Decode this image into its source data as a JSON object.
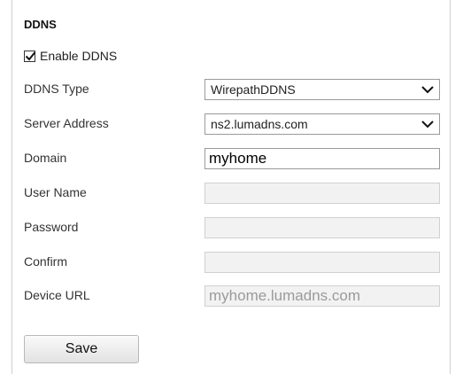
{
  "section_title": "DDNS",
  "enable": {
    "label": "Enable DDNS",
    "checked": true
  },
  "fields": {
    "ddns_type": {
      "label": "DDNS Type",
      "value": "WirepathDDNS"
    },
    "server_address": {
      "label": "Server Address",
      "value": "ns2.lumadns.com"
    },
    "domain": {
      "label": "Domain",
      "value": "myhome"
    },
    "user_name": {
      "label": "User Name",
      "value": ""
    },
    "password": {
      "label": "Password",
      "value": ""
    },
    "confirm": {
      "label": "Confirm",
      "value": ""
    },
    "device_url": {
      "label": "Device URL",
      "value": "myhome.lumadns.com"
    }
  },
  "save_label": "Save",
  "icons": {
    "check": "check-icon",
    "chevron": "chevron-down-icon"
  },
  "colors": {
    "border": "#9a9a9a",
    "disabled_bg": "#f2f2f2",
    "disabled_text": "#9a9a9a"
  }
}
